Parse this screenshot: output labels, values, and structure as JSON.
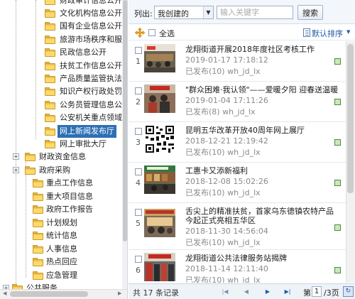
{
  "tree": {
    "nodes": [
      {
        "label": "财政审计信息公开"
      },
      {
        "label": "文化机构信息公开"
      },
      {
        "label": "国有企业信息公开"
      },
      {
        "label": "旅游市场秩序和服务"
      },
      {
        "label": "民政信息公开"
      },
      {
        "label": "扶贫工作信息公开"
      },
      {
        "label": "产品质量监管执法信"
      },
      {
        "label": "知识产权行政处罚信"
      },
      {
        "label": "公务员管理信息公开"
      },
      {
        "label": "公安机关重点领域信"
      },
      {
        "label": "网上新闻发布厅"
      },
      {
        "label": "网上审批大厅"
      },
      {
        "label": "财政资金信息"
      },
      {
        "label": "政府采购"
      },
      {
        "label": "重点工作信息"
      },
      {
        "label": "重大项目信息"
      },
      {
        "label": "政府工作报告"
      },
      {
        "label": "计划规划"
      },
      {
        "label": "统计信息"
      },
      {
        "label": "人事信息"
      },
      {
        "label": "热点回应"
      },
      {
        "label": "应急管理"
      },
      {
        "label": "公共服务"
      }
    ]
  },
  "filter": {
    "label": "列出:",
    "selected": "我创建的",
    "search_placeholder": "输入关键字",
    "search_button": "搜索"
  },
  "toolbar": {
    "select_all": "全选",
    "sort_label": "默认排序"
  },
  "items": [
    {
      "index": "1",
      "title": "龙翔街道开展2018年度社区考核工作",
      "date": "2019-01-17 17:18:12",
      "meta": "已发布(10)  wh_jd_lx"
    },
    {
      "index": "2",
      "title": "\"群众困难·我认领\"——爱暖夕阳 迎春送温暖",
      "date": "2019-01-04 17:11:26",
      "meta": "已发布(8)  wh_jd_lx"
    },
    {
      "index": "3",
      "title": "昆明五华改革开放40周年网上展厅",
      "date": "2018-12-21 12:19:42",
      "meta": "已发布(10)  wh_jd_lx"
    },
    {
      "index": "4",
      "title": "工惠卡又添新福利",
      "date": "2018-12-08 15:02:26",
      "meta": "已发布(10)  wh_jd_lx"
    },
    {
      "index": "5",
      "title": "舌尖上的精准扶贫，首家乌东德镇农特产品今起正式亮相五华区",
      "date": "2018-11-30 14:56:04",
      "meta": "已发布(10)  wh_jd_lx"
    },
    {
      "index": "6",
      "title": "龙翔街道公共法律服务站揭牌",
      "date": "2018-11-14 12:11:40",
      "meta": "已发布(10)  wh_jd_lx"
    }
  ],
  "pager": {
    "total": "共 17 条记录",
    "page_word": "第",
    "page_current": "1",
    "page_total": "/3页"
  }
}
